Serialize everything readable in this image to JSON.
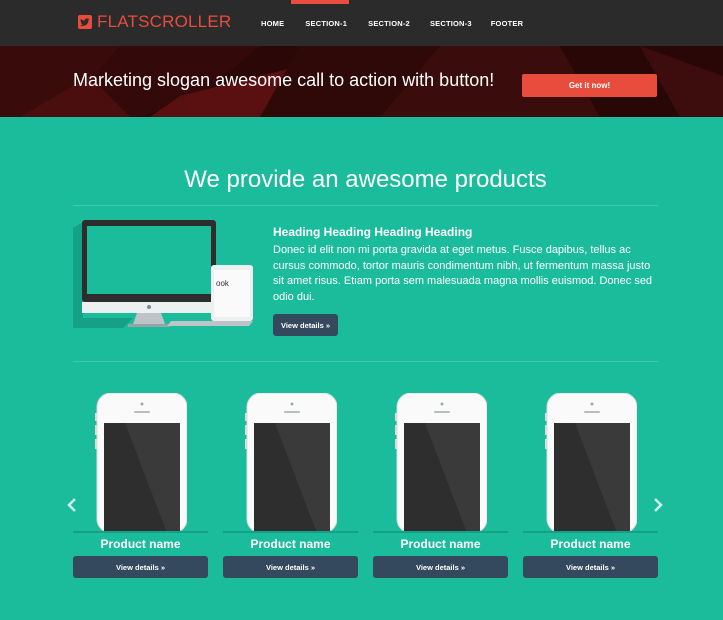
{
  "navbar": {
    "brand": "FLATSCROLLER",
    "links": [
      "HOME",
      "SECTION-1",
      "SECTION-2",
      "SECTION-3",
      "FOOTER"
    ]
  },
  "hero": {
    "slogan": "Marketing slogan awesome call to action with button!",
    "cta": "Get it now!"
  },
  "main": {
    "title": "We provide an awesome products",
    "feature": {
      "heading": "Heading Heading Heading Heading",
      "text": "Donec id elit non mi porta gravida at eget metus. Fusce dapibus, tellus ac cursus commodo, tortor mauris condimentum nibh, ut fermentum massa justo sit amet risus. Etiam porta sem malesuada magna mollis euismod. Donec sed odio dui.",
      "button": "View details »"
    }
  },
  "products": [
    {
      "name": "Product name",
      "button": "View details »"
    },
    {
      "name": "Product name",
      "button": "View details »"
    },
    {
      "name": "Product name",
      "button": "View details »"
    },
    {
      "name": "Product name",
      "button": "View details »"
    }
  ],
  "colors": {
    "navbar": "#2b2b2b",
    "accent": "#e74c3c",
    "background": "#1abc9c",
    "button": "#34495e"
  },
  "icons": [
    "twitter-icon",
    "chevron-left-icon",
    "chevron-right-icon"
  ]
}
